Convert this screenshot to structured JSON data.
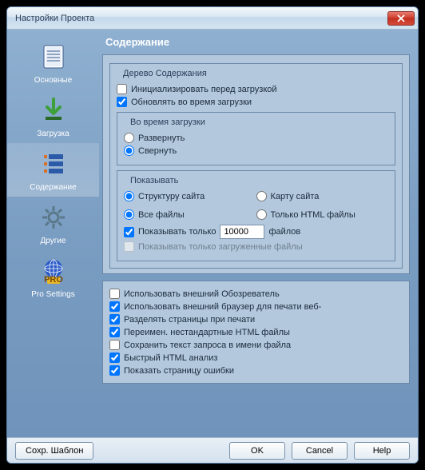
{
  "window": {
    "title": "Настройки Проекта"
  },
  "sidebar": {
    "items": [
      {
        "label": "Основные"
      },
      {
        "label": "Загрузка"
      },
      {
        "label": "Содержание"
      },
      {
        "label": "Другие"
      },
      {
        "label": "Pro Settings"
      }
    ]
  },
  "content": {
    "title": "Содержание",
    "tree": {
      "legend": "Дерево Содержания",
      "init_label": "Инициализировать перед загрузкой",
      "init_checked": false,
      "update_label": "Обновлять во время загрузки",
      "update_checked": true,
      "during": {
        "legend": "Во время загрузки",
        "expand": "Развернуть",
        "collapse": "Свернуть",
        "selected": "collapse"
      },
      "show": {
        "legend": "Показывать",
        "structure": "Структуру сайта",
        "map": "Карту сайта",
        "view_selected": "structure",
        "all_files": "Все файлы",
        "html_only": "Только HTML файлы",
        "files_selected": "all",
        "limit_label": "Показывать только",
        "limit_checked": true,
        "limit_value": "10000",
        "limit_suffix": "файлов",
        "downloaded_only_label": "Показывать только загруженные файлы",
        "downloaded_only_checked": false
      }
    },
    "options": {
      "ext_browser_view": {
        "label": "Использовать внешний Обозреватель",
        "checked": false
      },
      "ext_browser_print": {
        "label": "Использовать внешний браузер для печати веб-",
        "checked": true
      },
      "split_pages": {
        "label": "Разделять страницы при печати",
        "checked": true
      },
      "rename_html": {
        "label": "Переимен. нестандартные HTML файлы",
        "checked": true
      },
      "save_query": {
        "label": "Сохранить текст запроса в имени файла",
        "checked": false
      },
      "fast_html": {
        "label": "Быстрый HTML анализ",
        "checked": true
      },
      "show_error": {
        "label": "Показать страницу ошибки",
        "checked": true
      }
    }
  },
  "footer": {
    "save_template": "Сохр. Шаблон",
    "ok": "OK",
    "cancel": "Cancel",
    "help": "Help"
  }
}
